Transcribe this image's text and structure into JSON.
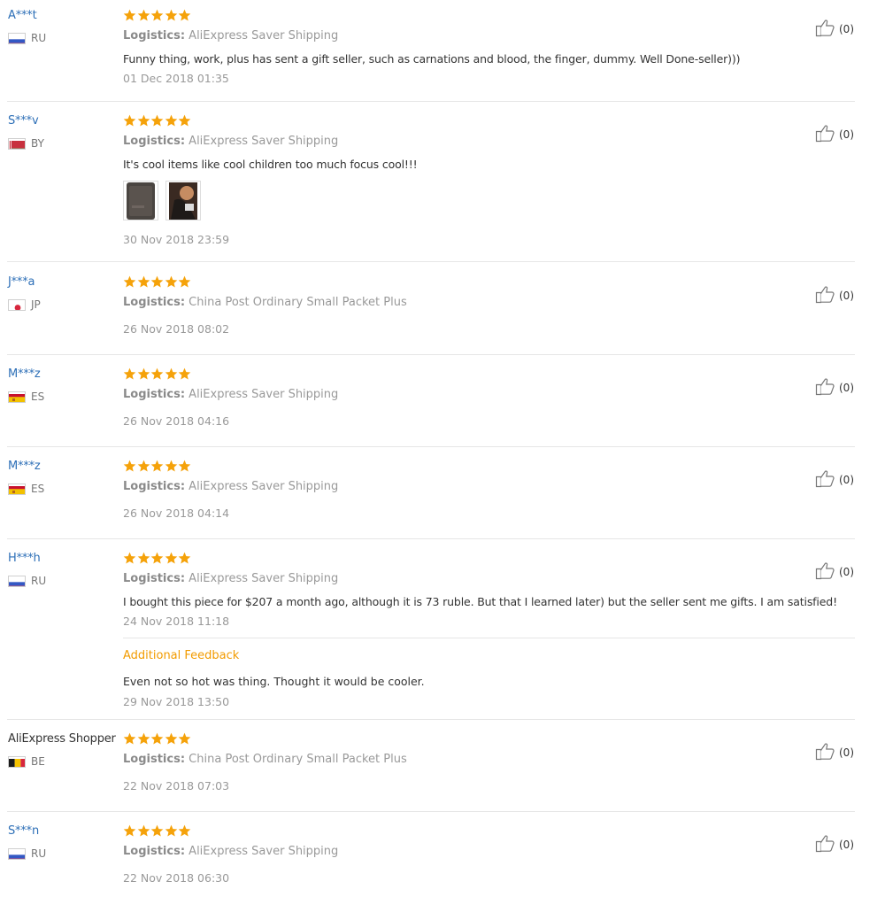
{
  "colors": {
    "star": "#f5a20a",
    "user_link": "#2d6fb7",
    "additional_feedback": "#f29b00",
    "muted": "#999999"
  },
  "logistics_label": "Logistics:",
  "reviews": [
    {
      "user": "A***t",
      "country": "RU",
      "flag": "flag-russia",
      "rating": 5,
      "logistics": "AliExpress Saver Shipping",
      "text": "Funny thing, work, plus has sent a gift seller, such as carnations and blood, the finger, dummy. Well Done-seller)))",
      "date": "01 Dec 2018 01:35",
      "helpful": "(0)"
    },
    {
      "user": "S***v",
      "country": "BY",
      "flag": "flag-belarus",
      "rating": 5,
      "logistics": "AliExpress Saver Shipping",
      "text": "It's cool items like cool children too much focus cool!!!",
      "photos": [
        "photo-thumbnail-1",
        "photo-thumbnail-2"
      ],
      "date": "30 Nov 2018 23:59",
      "helpful": "(0)"
    },
    {
      "user": "J***a",
      "country": "JP",
      "flag": "flag-japan",
      "rating": 5,
      "logistics": "China Post Ordinary Small Packet Plus",
      "date": "26 Nov 2018 08:02",
      "helpful": "(0)"
    },
    {
      "user": "M***z",
      "country": "ES",
      "flag": "flag-spain",
      "rating": 5,
      "logistics": "AliExpress Saver Shipping",
      "date": "26 Nov 2018 04:16",
      "helpful": "(0)"
    },
    {
      "user": "M***z",
      "country": "ES",
      "flag": "flag-spain",
      "rating": 5,
      "logistics": "AliExpress Saver Shipping",
      "date": "26 Nov 2018 04:14",
      "helpful": "(0)"
    },
    {
      "user": "H***h",
      "country": "RU",
      "flag": "flag-russia",
      "rating": 5,
      "logistics": "AliExpress Saver Shipping",
      "text": "I bought this piece for $207 a month ago, although it is 73 ruble. But that I learned later) but the seller sent me gifts. I am satisfied!",
      "date": "24 Nov 2018 11:18",
      "additional_title": "Additional Feedback",
      "additional_text": "Even not so hot was thing. Thought it would be cooler.",
      "additional_date": "29 Nov 2018 13:50",
      "helpful": "(0)"
    },
    {
      "user": "AliExpress Shopper",
      "country": "BE",
      "flag": "flag-belgium",
      "rating": 5,
      "logistics": "China Post Ordinary Small Packet Plus",
      "date": "22 Nov 2018 07:03",
      "helpful": "(0)"
    },
    {
      "user": "S***n",
      "country": "RU",
      "flag": "flag-russia",
      "rating": 5,
      "logistics": "AliExpress Saver Shipping",
      "date": "22 Nov 2018 06:30",
      "helpful": "(0)"
    }
  ]
}
